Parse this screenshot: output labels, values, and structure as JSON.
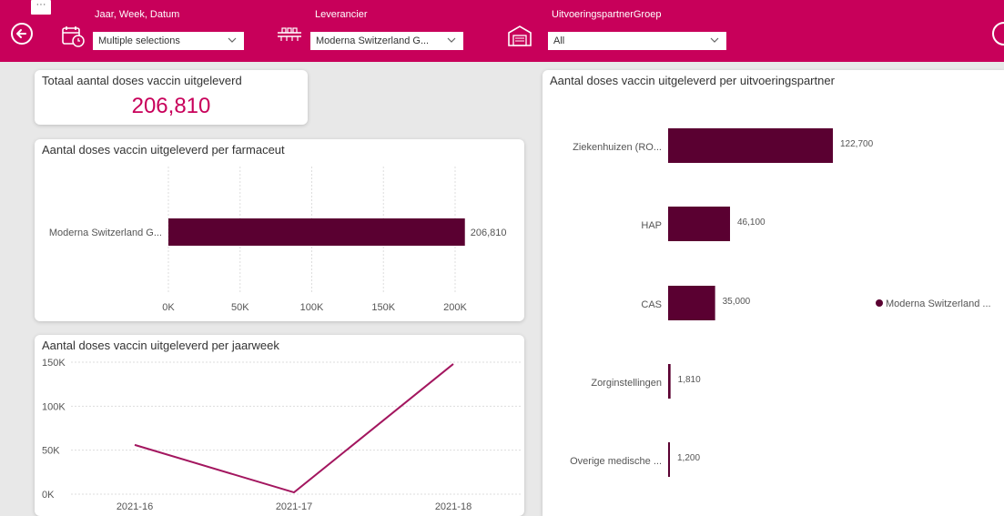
{
  "toolbar": {
    "more_options": "···"
  },
  "filters": [
    {
      "label": "Jaar, Week, Datum",
      "value": "Multiple selections",
      "icon": "calendar-icon"
    },
    {
      "label": "Leverancier",
      "value": "Moderna Switzerland G...",
      "icon": "factory-icon"
    },
    {
      "label": "UitvoeringspartnerGroep",
      "value": "All",
      "icon": "warehouse-icon"
    }
  ],
  "kpi": {
    "title": "Totaal aantal doses vaccin uitgeleverd",
    "value": "206,810"
  },
  "colors": {
    "brand": "#c8005a",
    "bar": "#5a0031",
    "line": "#a3165f",
    "background": "#e8e8e8"
  },
  "chart_data": [
    {
      "type": "bar",
      "orientation": "horizontal",
      "title": "Aantal doses vaccin uitgeleverd per farmaceut",
      "categories": [
        "Moderna Switzerland G..."
      ],
      "values": [
        206810
      ],
      "data_labels": [
        "206,810"
      ],
      "x_ticks": [
        "0K",
        "50K",
        "100K",
        "150K",
        "200K"
      ],
      "xlim": [
        0,
        200000
      ],
      "grid": true
    },
    {
      "type": "line",
      "title": "Aantal doses vaccin uitgeleverd per jaarweek",
      "x": [
        "2021-16",
        "2021-17",
        "2021-18"
      ],
      "values": [
        56000,
        2000,
        148000
      ],
      "y_ticks": [
        "0K",
        "50K",
        "100K",
        "150K"
      ],
      "ylim": [
        0,
        150000
      ],
      "grid": true
    },
    {
      "type": "bar",
      "orientation": "horizontal",
      "title": "Aantal doses vaccin uitgeleverd per uitvoeringspartner",
      "categories": [
        "Ziekenhuizen (RO...",
        "HAP",
        "CAS",
        "Zorginstellingen",
        "Overige medische ..."
      ],
      "values": [
        122700,
        46100,
        35000,
        1810,
        1200
      ],
      "data_labels": [
        "122,700",
        "46,100",
        "35,000",
        "1,810",
        "1,200"
      ],
      "legend": {
        "entries": [
          "Moderna Switzerland ..."
        ],
        "placement": "right"
      }
    }
  ]
}
